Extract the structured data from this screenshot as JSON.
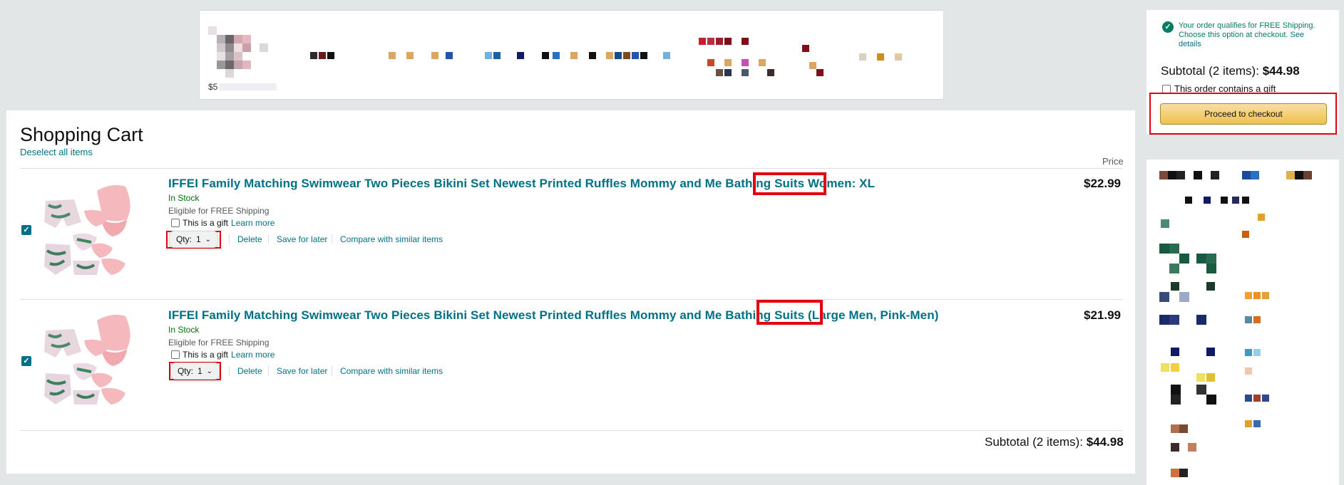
{
  "cart": {
    "title": "Shopping Cart",
    "deselect_label": "Deselect all items",
    "price_header": "Price",
    "items": [
      {
        "title": "IFFEI Family Matching Swimwear Two Pieces Bikini Set Newest Printed Ruffles Mommy and Me Bathing Suits",
        "variant": "Women: XL",
        "variant_suffix": "",
        "stock": "In Stock",
        "shipping": "Eligible for FREE Shipping",
        "gift_label": "This is a gift",
        "learn_more": "Learn more",
        "qty_label": "Qty:",
        "qty_value": "1",
        "delete_label": "Delete",
        "save_label": "Save for later",
        "compare_label": "Compare with similar items",
        "price": "$22.99",
        "selected": true
      },
      {
        "title": "IFFEI Family Matching Swimwear Two Pieces Bikini Set Newest Printed Ruffles Mommy and Me Bathing Suits",
        "variant": "(Large Men",
        "variant_suffix": ", Pink-Men)",
        "stock": "In Stock",
        "shipping": "Eligible for FREE Shipping",
        "gift_label": "This is a gift",
        "learn_more": "Learn more",
        "qty_label": "Qty:",
        "qty_value": "1",
        "delete_label": "Delete",
        "save_label": "Save for later",
        "compare_label": "Compare with similar items",
        "price": "$21.99",
        "selected": true
      }
    ],
    "subtotal_label": "Subtotal (2 items):",
    "subtotal_value": "$44.98"
  },
  "summary": {
    "free_shipping_msg": "Your order qualifies for FREE Shipping. Choose this option at checkout.",
    "see_details": "See details",
    "subtotal_label": "Subtotal (2 items):",
    "subtotal_value": "$44.98",
    "gift_order_label": "This order contains a gift",
    "checkout_label": "Proceed to checkout"
  },
  "ad": {
    "price_fragment": "$5"
  },
  "colors": {
    "link": "#007185",
    "in_stock": "#007600",
    "highlight": "#e3000f",
    "checkout_button": "#f0c14b"
  }
}
